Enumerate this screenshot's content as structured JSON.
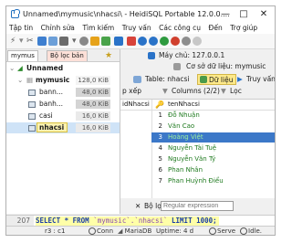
{
  "window": {
    "title": "Unnamed\\mymusic\\nhacsi\\ - HeidiSQL Portable 12.0.0....",
    "minimize": "—",
    "maximize": "□",
    "close": "✕"
  },
  "menu": [
    "Tập tin",
    "Chỉnh sửa",
    "Tìm kiếm",
    "Truy vấn",
    "Các công cụ",
    "Đến",
    "Trợ giúp"
  ],
  "left_panel": {
    "tabs": [
      "mymus",
      "Bộ lọc bản"
    ],
    "session": "Unnamed",
    "database": {
      "name": "mymusic",
      "size": "128,0 KiB"
    },
    "tables": [
      {
        "name": "bann...",
        "size": "48,0 KiB"
      },
      {
        "name": "banh...",
        "size": "48,0 KiB"
      },
      {
        "name": "casi",
        "size": "16,0 KiB"
      },
      {
        "name": "nhacsi",
        "size": "16,0 KiB"
      }
    ]
  },
  "right_panel": {
    "host": "Máy chủ: 127.0.0.1",
    "database_label": "Cơ sở dữ liệu: mymusic",
    "tabs": [
      "Table: nhacsi",
      "Dữ liệu",
      "Truy vấn"
    ],
    "active_tab": "Dữ liệu",
    "sort_label": "p xếp",
    "columns_label": "Columns (2/2)",
    "filter_label": "Lọc",
    "grid": {
      "headers": [
        "idNhacsi",
        "tenNhacsi"
      ],
      "rows": [
        {
          "id": "1",
          "name": "Đỗ Nhuận"
        },
        {
          "id": "2",
          "name": "Văn Cao"
        },
        {
          "id": "3",
          "name": "Hoàng Việt"
        },
        {
          "id": "4",
          "name": "Nguyễn Tài Tuệ"
        },
        {
          "id": "5",
          "name": "Nguyễn Văn Tý"
        },
        {
          "id": "6",
          "name": "Phan Nhân"
        },
        {
          "id": "7",
          "name": "Phan Huỳnh Điểu"
        }
      ],
      "selected_row": 3
    },
    "bottom_filter_label": "Bộ lọc",
    "regex_placeholder": "Regular expression"
  },
  "query": {
    "line_number": "207",
    "select_kw": "SELECT * FROM",
    "table_ref": "`mymusic`.`nhacsi`",
    "limit_kw": "LIMIT 1000;"
  },
  "status": {
    "position": "r3 : c1",
    "connected": "Conn",
    "server": "MariaDB",
    "uptime": "Uptime: 4 d",
    "server_state": "Serve",
    "idle": "Idle."
  }
}
